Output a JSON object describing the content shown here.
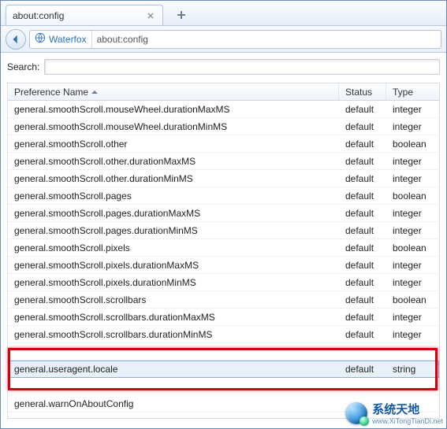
{
  "tab": {
    "title": "about:config"
  },
  "toolbar": {
    "identity_name": "Waterfox",
    "url": "about:config"
  },
  "search": {
    "label": "Search:",
    "value": ""
  },
  "columns": {
    "name": "Preference Name",
    "status": "Status",
    "type": "Type"
  },
  "rows": [
    {
      "name": "general.smoothScroll.mouseWheel.durationMaxMS",
      "status": "default",
      "type": "integer"
    },
    {
      "name": "general.smoothScroll.mouseWheel.durationMinMS",
      "status": "default",
      "type": "integer"
    },
    {
      "name": "general.smoothScroll.other",
      "status": "default",
      "type": "boolean"
    },
    {
      "name": "general.smoothScroll.other.durationMaxMS",
      "status": "default",
      "type": "integer"
    },
    {
      "name": "general.smoothScroll.other.durationMinMS",
      "status": "default",
      "type": "integer"
    },
    {
      "name": "general.smoothScroll.pages",
      "status": "default",
      "type": "boolean"
    },
    {
      "name": "general.smoothScroll.pages.durationMaxMS",
      "status": "default",
      "type": "integer"
    },
    {
      "name": "general.smoothScroll.pages.durationMinMS",
      "status": "default",
      "type": "integer"
    },
    {
      "name": "general.smoothScroll.pixels",
      "status": "default",
      "type": "boolean"
    },
    {
      "name": "general.smoothScroll.pixels.durationMaxMS",
      "status": "default",
      "type": "integer"
    },
    {
      "name": "general.smoothScroll.pixels.durationMinMS",
      "status": "default",
      "type": "integer"
    },
    {
      "name": "general.smoothScroll.scrollbars",
      "status": "default",
      "type": "boolean"
    },
    {
      "name": "general.smoothScroll.scrollbars.durationMaxMS",
      "status": "default",
      "type": "integer"
    },
    {
      "name": "general.smoothScroll.scrollbars.durationMinMS",
      "status": "default",
      "type": "integer"
    }
  ],
  "highlighted_row": {
    "name": "general.useragent.locale",
    "status": "default",
    "type": "string"
  },
  "after_row": {
    "name": "general.warnOnAboutConfig",
    "status": "",
    "type": ""
  },
  "watermark": {
    "top": "系统天地",
    "bottom": "www.XiTongTianDi.net"
  }
}
